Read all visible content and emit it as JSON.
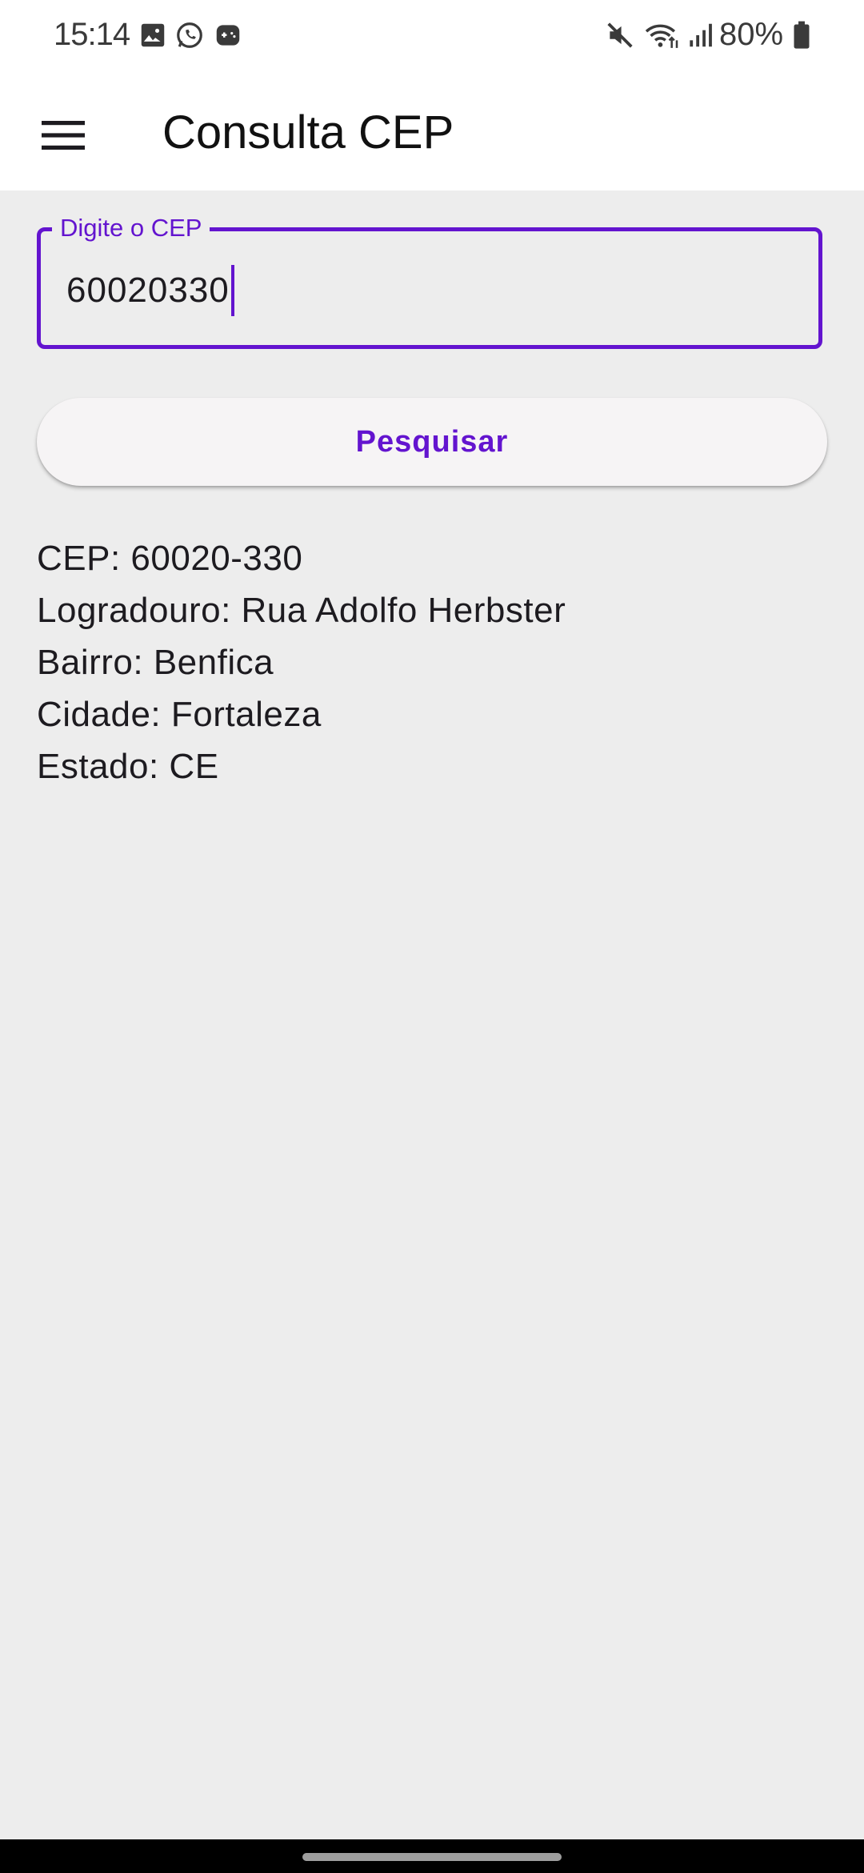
{
  "status_bar": {
    "time": "15:14",
    "battery": "80%",
    "icons": [
      "image-icon",
      "whatsapp-icon",
      "game-icon",
      "mute-icon",
      "wifi-icon",
      "signal-icon",
      "battery-icon"
    ]
  },
  "app_bar": {
    "title": "Consulta CEP",
    "menu_icon": "hamburger-menu-icon"
  },
  "cep_field": {
    "label": "Digite o CEP",
    "value": "60020330"
  },
  "search_button": {
    "label": "Pesquisar"
  },
  "result": {
    "cep": "CEP: 60020-330",
    "logradouro": "Logradouro: Rua Adolfo Herbster",
    "bairro": "Bairro: Benfica",
    "cidade": "Cidade: Fortaleza",
    "estado": "Estado: CE"
  },
  "colors": {
    "accent": "#6314cf",
    "background": "#ededed",
    "app_bar": "#ffffff",
    "text": "#1d1b20"
  }
}
